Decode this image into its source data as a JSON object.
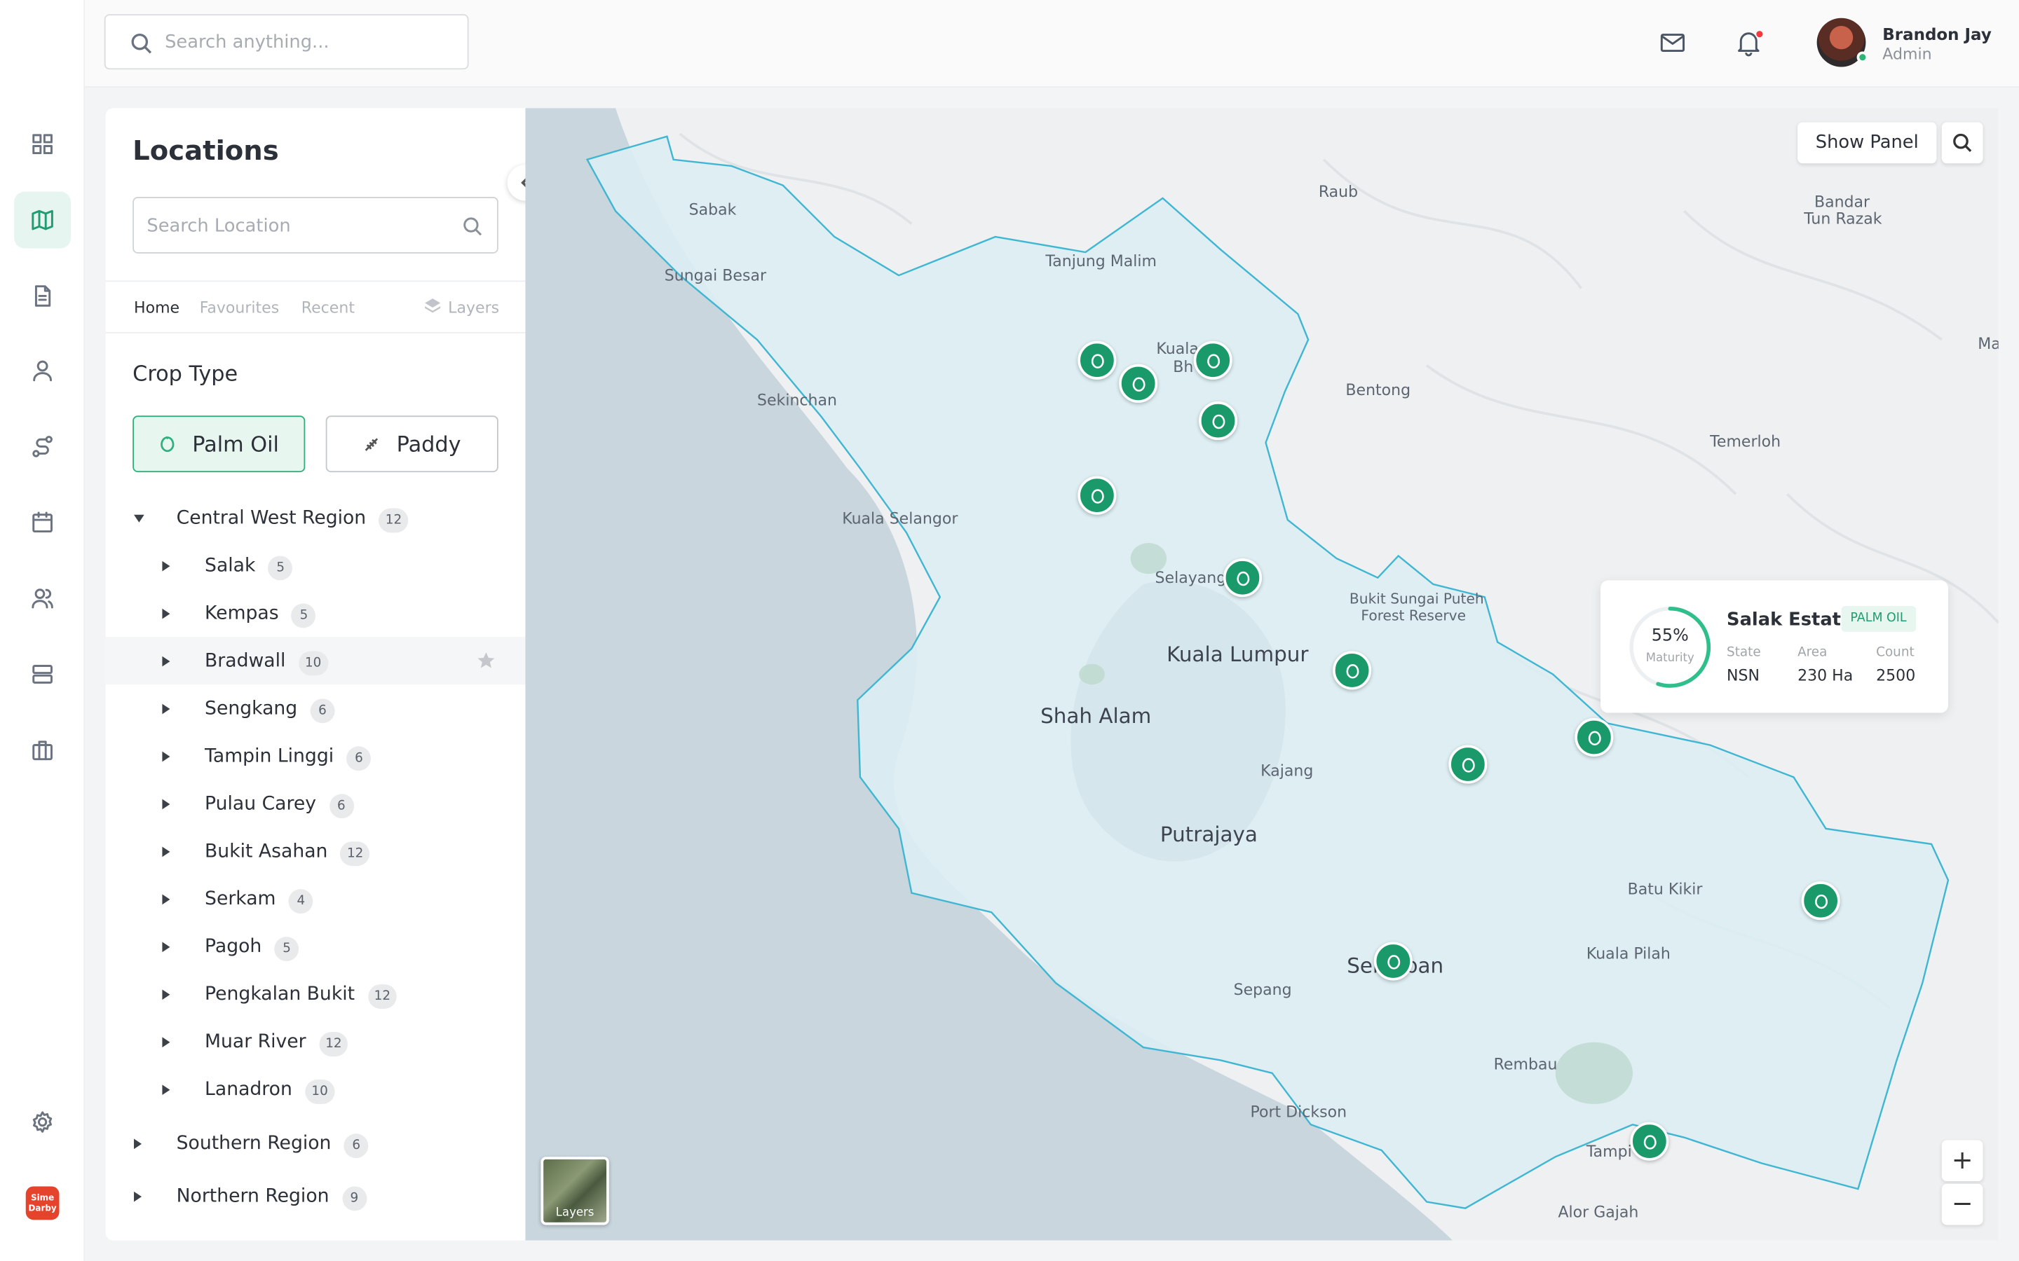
{
  "header": {
    "search_placeholder": "Search anything...",
    "user_name": "Brandon Jay",
    "user_role": "Admin"
  },
  "sidebar_icons": [
    "grid-icon",
    "map-icon",
    "document-icon",
    "user-icon",
    "route-icon",
    "calendar-icon",
    "team-icon",
    "server-icon",
    "briefcase-icon",
    "settings-icon"
  ],
  "brand": {
    "logo_text_1": "Sime",
    "logo_text_2": "Darby",
    "logo_color": "#e5432c"
  },
  "panel": {
    "title": "Locations",
    "search_placeholder": "Search Location",
    "tabs": [
      "Home",
      "Favourites",
      "Recent",
      "Layers"
    ],
    "crop_type_label": "Crop Type",
    "crop_buttons": [
      "Palm Oil",
      "Paddy"
    ],
    "regions": [
      {
        "name": "Central West Region",
        "count": "12",
        "expanded": true,
        "children": [
          {
            "name": "Salak",
            "count": "5"
          },
          {
            "name": "Kempas",
            "count": "5"
          },
          {
            "name": "Bradwall",
            "count": "10"
          },
          {
            "name": "Sengkang",
            "count": "6"
          },
          {
            "name": "Tampin Linggi",
            "count": "6"
          },
          {
            "name": "Pulau Carey",
            "count": "6"
          },
          {
            "name": "Bukit Asahan",
            "count": "12"
          },
          {
            "name": "Serkam",
            "count": "4"
          },
          {
            "name": "Pagoh",
            "count": "5"
          },
          {
            "name": "Pengkalan Bukit",
            "count": "12"
          },
          {
            "name": "Muar River",
            "count": "12"
          },
          {
            "name": "Lanadron",
            "count": "10"
          }
        ]
      },
      {
        "name": "Southern Region",
        "count": "6",
        "expanded": false
      },
      {
        "name": "Northern Region",
        "count": "9",
        "expanded": false
      }
    ]
  },
  "map": {
    "show_panel_label": "Show Panel",
    "layers_label": "Layers",
    "zoom_in": "+",
    "zoom_out": "−",
    "places": [
      "Sabak",
      "Sungai Besar",
      "Tanjung Malim",
      "Raub",
      "Bandar",
      "Tun Razak",
      "Ma",
      "Kuala",
      "Bh",
      "Sekinchan",
      "Bentong",
      "Temerloh",
      "Kuala Selangor",
      "Selayang",
      "Bukit Sungai Puteh",
      "Forest Reserve",
      "Kuala Lumpur",
      "Shah Alam",
      "Kajang",
      "Putrajaya",
      "Batu Kikir",
      "Kuala Pilah",
      "Ser",
      "ban",
      "Sepang",
      "Rembau",
      "Port Dickson",
      "Tampi",
      "Alor Gajah"
    ],
    "estate_card": {
      "name": "Salak Estate",
      "crop_badge": "PALM OIL",
      "maturity_pct": "55%",
      "maturity_value": 0.55,
      "maturity_label": "Maturity",
      "state_label": "State",
      "state_value": "NSN",
      "area_label": "Area",
      "area_value": "230 Ha",
      "count_label": "Count",
      "count_value": "2500"
    }
  },
  "colors": {
    "accent": "#1f9d72",
    "pin": "#1a9a6a",
    "region_fill": "#dcedf3",
    "region_stroke": "#3fb6d2",
    "sea": "#c9d6de",
    "notification": "#ef3b3b"
  }
}
